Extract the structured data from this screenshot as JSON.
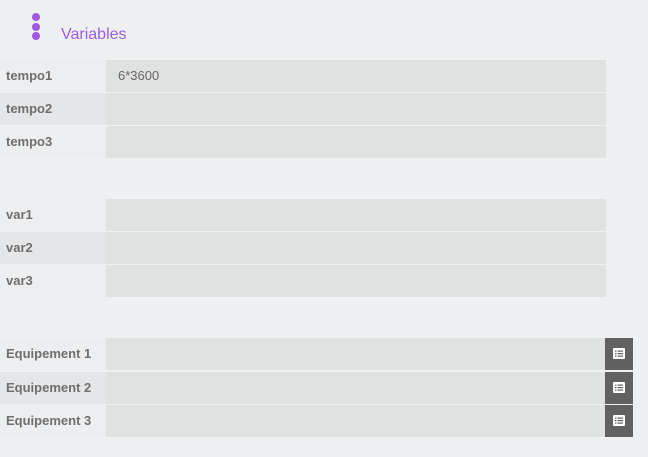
{
  "header": {
    "menu_icon": "vertical-dots-icon",
    "title": "Variables"
  },
  "group1": {
    "rows": [
      {
        "label": "tempo1",
        "value": "6*3600"
      },
      {
        "label": "tempo2",
        "value": ""
      },
      {
        "label": "tempo3",
        "value": ""
      }
    ]
  },
  "group2": {
    "rows": [
      {
        "label": "var1",
        "value": ""
      },
      {
        "label": "var2",
        "value": ""
      },
      {
        "label": "var3",
        "value": ""
      }
    ]
  },
  "group3": {
    "button_icon": "list-icon",
    "rows": [
      {
        "label": "Equipement 1",
        "value": ""
      },
      {
        "label": "Equipement 2",
        "value": ""
      },
      {
        "label": "Equipement 3",
        "value": ""
      }
    ]
  },
  "colors": {
    "accent": "#9b5de5",
    "background": "#eff0f2",
    "field": "#e0e1e1",
    "button": "#616161"
  }
}
